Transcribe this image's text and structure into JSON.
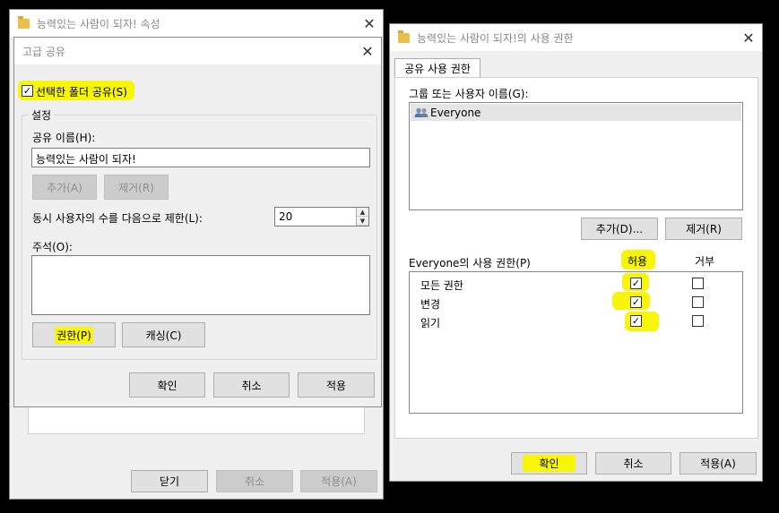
{
  "props_window": {
    "title": "능력있는 사람이 되자! 속성",
    "bottom_buttons": {
      "close": "닫기",
      "cancel": "취소",
      "apply": "적용(A)"
    }
  },
  "adv_share": {
    "title": "고급 공유",
    "share_checkbox": {
      "label": "선택한 폴더 공유(S)",
      "checked": "✓"
    },
    "settings_group": "설정",
    "share_name_label": "공유 이름(H):",
    "share_name_value": "능력있는 사람이 되자!",
    "add_button": "추가(A)",
    "remove_button": "제거(R)",
    "user_limit_label": "동시 사용자의 수를 다음으로 제한(L):",
    "user_limit_value": "20",
    "comment_label": "주석(O):",
    "comment_value": "",
    "permissions_button": "권한(P)",
    "caching_button": "캐싱(C)",
    "ok": "확인",
    "cancel": "취소",
    "apply": "적용"
  },
  "permissions": {
    "title": "능력있는 사람이 되자!의 사용 권한",
    "tab": "공유 사용 권한",
    "group_label": "그룹 또는 사용자 이름(G):",
    "users": [
      "Everyone"
    ],
    "add_button": "추가(D)...",
    "remove_button": "제거(R)",
    "perm_header": "Everyone의 사용 권한(P)",
    "allow_header": "허용",
    "deny_header": "거부",
    "rows": [
      {
        "name": "모든 권한",
        "allow": "✓",
        "deny": ""
      },
      {
        "name": "변경",
        "allow": "✓",
        "deny": ""
      },
      {
        "name": "읽기",
        "allow": "✓",
        "deny": ""
      }
    ],
    "ok": "확인",
    "cancel": "취소",
    "apply": "적용(A)"
  },
  "colors": {
    "highlight": "#f7f50a",
    "accent": "#0078d7"
  }
}
